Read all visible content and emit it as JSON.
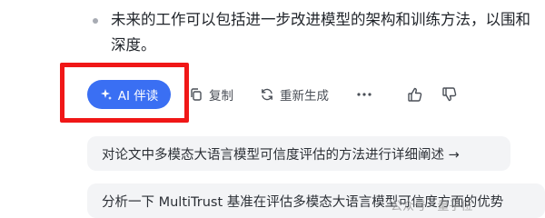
{
  "message": {
    "bullet_text": "未来的工作可以包括进一步改进模型的架构和训练方法，以围和深度。"
  },
  "actions": {
    "ai_button_label": "AI 伴读",
    "copy_label": "复制",
    "regenerate_label": "重新生成"
  },
  "suggestions": [
    "对论文中多模态大语言模型可信度评估的方法进行详细阐述 →",
    "分析一下 MultiTrust 基准在评估多模态大语言模型可信度方面的优势"
  ],
  "watermark": {
    "text": "公众号 · 量子位"
  },
  "colors": {
    "accent": "#3a6ff3",
    "annotation_border": "#f01717",
    "suggestion_bg": "#f3f4f6"
  }
}
